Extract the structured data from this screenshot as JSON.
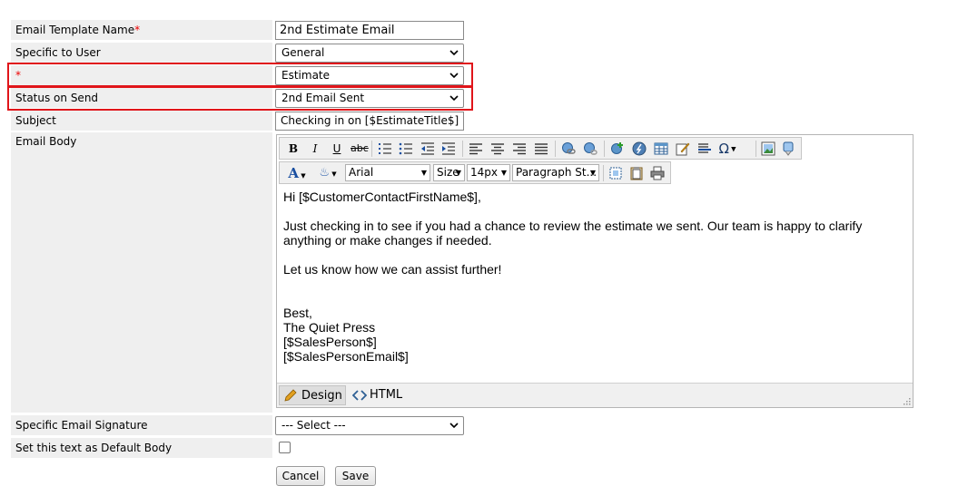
{
  "form": {
    "template_name_label": "Email Template Name",
    "required_mark": "*",
    "template_name_value": "2nd Estimate Email",
    "specific_user_label": "Specific to User",
    "specific_user_value": "General",
    "type_label": "",
    "type_value": "Estimate",
    "status_label": "Status on Send",
    "status_value": "2nd Email Sent",
    "subject_label": "Subject",
    "subject_value": "Checking in on [$EstimateTitle$]",
    "body_label": "Email Body",
    "signature_label": "Specific Email Signature",
    "signature_value": "--- Select ---",
    "default_body_label": "Set this text as Default Body",
    "default_body_checked": false,
    "cancel_label": "Cancel",
    "save_label": "Save"
  },
  "editor": {
    "font_name": "Arial",
    "size_label": "Size",
    "font_size": "14px",
    "paragraph_style": "Paragraph St...",
    "design_tab": "Design",
    "html_tab": "HTML",
    "body_lines": [
      "Hi [$CustomerContactFirstName$],",
      "",
      "Just checking in to see if you had a chance to review the estimate we sent. Our team is happy to clarify anything or make changes if needed.",
      "",
      "Let us know how we can assist further!",
      "",
      "",
      "Best,",
      "The Quiet Press",
      "[$SalesPerson$]",
      "[$SalesPersonEmail$]"
    ],
    "toolbar_icons": [
      "bold-icon",
      "italic-icon",
      "underline-icon",
      "strikethrough-icon",
      "ordered-list-icon",
      "unordered-list-icon",
      "outdent-icon",
      "indent-icon",
      "align-left-icon",
      "align-center-icon",
      "align-right-icon",
      "justify-icon",
      "link-icon",
      "unlink-icon",
      "insert-link-icon",
      "flash-icon",
      "table-icon",
      "edit-icon",
      "horizontal-rule-icon",
      "special-char-icon",
      "image-icon",
      "media-icon",
      "font-color-icon",
      "highlight-icon",
      "select-all-icon",
      "paste-icon",
      "print-icon"
    ]
  },
  "colors": {
    "highlight_border": "#e0151a",
    "label_bg": "#efefef",
    "required": "#ee0000"
  }
}
